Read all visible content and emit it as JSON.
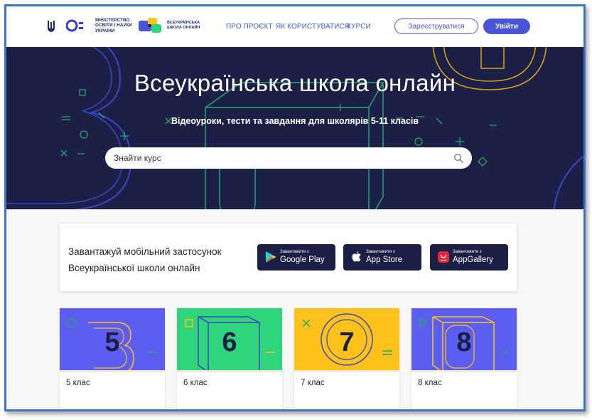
{
  "header": {
    "ministry_lines": [
      "МІНІСТЕРСТВО",
      "ОСВІТИ І НАУКИ",
      "УКРАЇНИ"
    ],
    "school_logo_lines": [
      "ВСЕУКРАЇНСЬКА",
      "ШКОЛА ОНЛАЙН"
    ],
    "nav": {
      "about": "ПРО ПРОЄКТ",
      "how_to_use": "ЯК КОРИСТУВАТИСЯ",
      "courses": "КУРСИ"
    },
    "register_label": "Зареєструватися",
    "login_label": "Увійти"
  },
  "hero": {
    "title": "Всеукраїнська школа онлайн",
    "subtitle": "Відеоуроки, тести та завдання для школярів 5-11 класів",
    "search_placeholder": "Знайти курс"
  },
  "app_banner": {
    "text_line1": "Завантажуй мобільний застосунок",
    "text_line2": "Всеукраїнської школи онлайн",
    "stores": [
      {
        "small": "Завантажити з",
        "name": "Google Play",
        "icon": "google-play-icon"
      },
      {
        "small": "Завантажити з",
        "name": "App Store",
        "icon": "apple-icon"
      },
      {
        "small": "Завантажити з",
        "name": "AppGallery",
        "icon": "huawei-appgallery-icon"
      }
    ]
  },
  "grades": [
    {
      "number": "5",
      "label": "5 клас",
      "color": "#5b5ef0"
    },
    {
      "number": "6",
      "label": "6 клас",
      "color": "#2fd57a"
    },
    {
      "number": "7",
      "label": "7 клас",
      "color": "#ffc21a"
    },
    {
      "number": "8",
      "label": "8 клас",
      "color": "#5b5ef0"
    }
  ],
  "colors": {
    "primary": "#4a55d6",
    "hero_bg": "#1c1f46",
    "frame_border": "#3f73c8"
  }
}
